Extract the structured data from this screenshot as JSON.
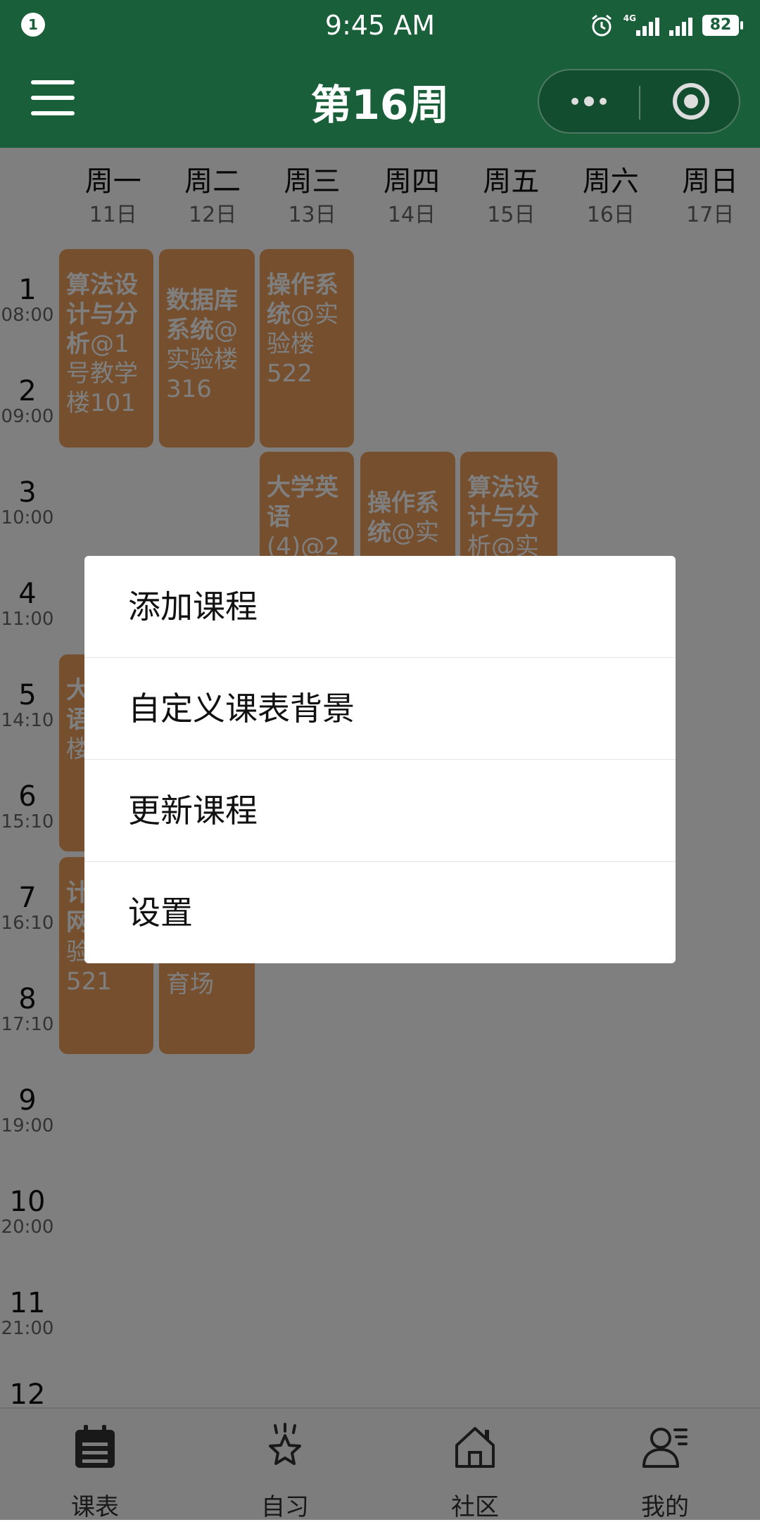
{
  "status_bar": {
    "notification_count": "1",
    "time": "9:45 AM",
    "network": "4G",
    "battery": "82"
  },
  "nav": {
    "title": "第16周"
  },
  "week": [
    {
      "name": "周一",
      "date": "11日"
    },
    {
      "name": "周二",
      "date": "12日"
    },
    {
      "name": "周三",
      "date": "13日"
    },
    {
      "name": "周四",
      "date": "14日"
    },
    {
      "name": "周五",
      "date": "15日"
    },
    {
      "name": "周六",
      "date": "16日"
    },
    {
      "name": "周日",
      "date": "17日"
    }
  ],
  "slots": [
    {
      "num": "1",
      "time": "08:00"
    },
    {
      "num": "2",
      "time": "09:00"
    },
    {
      "num": "3",
      "time": "10:00"
    },
    {
      "num": "4",
      "time": "11:00"
    },
    {
      "num": "5",
      "time": "14:10"
    },
    {
      "num": "6",
      "time": "15:10"
    },
    {
      "num": "7",
      "time": "16:10"
    },
    {
      "num": "8",
      "time": "17:10"
    },
    {
      "num": "9",
      "time": "19:00"
    },
    {
      "num": "10",
      "time": "20:00"
    },
    {
      "num": "11",
      "time": "21:00"
    },
    {
      "num": "12",
      "time": ""
    }
  ],
  "courses": [
    {
      "bold": "算法设计与分析",
      "rest": "@1号教学楼101"
    },
    {
      "bold": "数据库系统",
      "rest": "@实验楼316"
    },
    {
      "bold": "操作系统",
      "rest": "@实验楼522"
    },
    {
      "bold": "大学英语",
      "rest": "(4)@2"
    },
    {
      "bold": "操作系统",
      "rest": "@实"
    },
    {
      "bold": "算法设计与分",
      "rest": "析@实"
    },
    {
      "bold": "大学英语",
      "rest": "实验楼20"
    },
    {
      "bold": "计算机网络",
      "rest": "实验楼521"
    },
    {
      "bold": "",
      "rest": "育场"
    }
  ],
  "menu": {
    "items": [
      "添加课程",
      "自定义课表背景",
      "更新课程",
      "设置"
    ]
  },
  "tabbar": {
    "items": [
      "课表",
      "自习",
      "社区",
      "我的"
    ]
  },
  "colors": {
    "brand_green": "#185f3a",
    "course_orange": "#ec9f5c"
  }
}
